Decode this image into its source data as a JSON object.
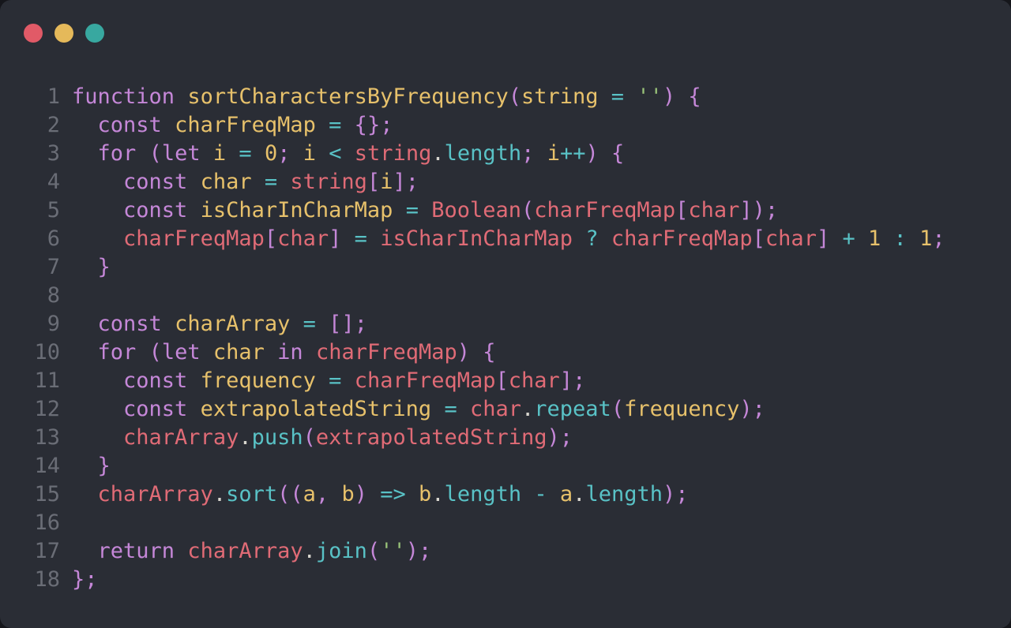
{
  "window": {
    "controls": [
      {
        "name": "close",
        "color": "#e15a67"
      },
      {
        "name": "minimize",
        "color": "#e5b95a"
      },
      {
        "name": "zoom",
        "color": "#38a8a0"
      }
    ]
  },
  "colors": {
    "background": "#2a2d35",
    "keyword": "#c587d8",
    "function": "#e7c16b",
    "variable": "#e06b76",
    "operator": "#59c2c6",
    "string": "#99c379",
    "line_number": "#6a6d76"
  },
  "code": {
    "language": "javascript",
    "lines": [
      {
        "n": "1",
        "text": "function sortCharactersByFrequency(string = '') {"
      },
      {
        "n": "2",
        "text": "  const charFreqMap = {};"
      },
      {
        "n": "3",
        "text": "  for (let i = 0; i < string.length; i++) {"
      },
      {
        "n": "4",
        "text": "    const char = string[i];"
      },
      {
        "n": "5",
        "text": "    const isCharInCharMap = Boolean(charFreqMap[char]);"
      },
      {
        "n": "6",
        "text": "    charFreqMap[char] = isCharInCharMap ? charFreqMap[char] + 1 : 1;"
      },
      {
        "n": "7",
        "text": "  }"
      },
      {
        "n": "8",
        "text": ""
      },
      {
        "n": "9",
        "text": "  const charArray = [];"
      },
      {
        "n": "10",
        "text": "  for (let char in charFreqMap) {"
      },
      {
        "n": "11",
        "text": "    const frequency = charFreqMap[char];"
      },
      {
        "n": "12",
        "text": "    const extrapolatedString = char.repeat(frequency);"
      },
      {
        "n": "13",
        "text": "    charArray.push(extrapolatedString);"
      },
      {
        "n": "14",
        "text": "  }"
      },
      {
        "n": "15",
        "text": "  charArray.sort((a, b) => b.length - a.length);"
      },
      {
        "n": "16",
        "text": ""
      },
      {
        "n": "17",
        "text": "  return charArray.join('');"
      },
      {
        "n": "18",
        "text": "};"
      }
    ]
  }
}
